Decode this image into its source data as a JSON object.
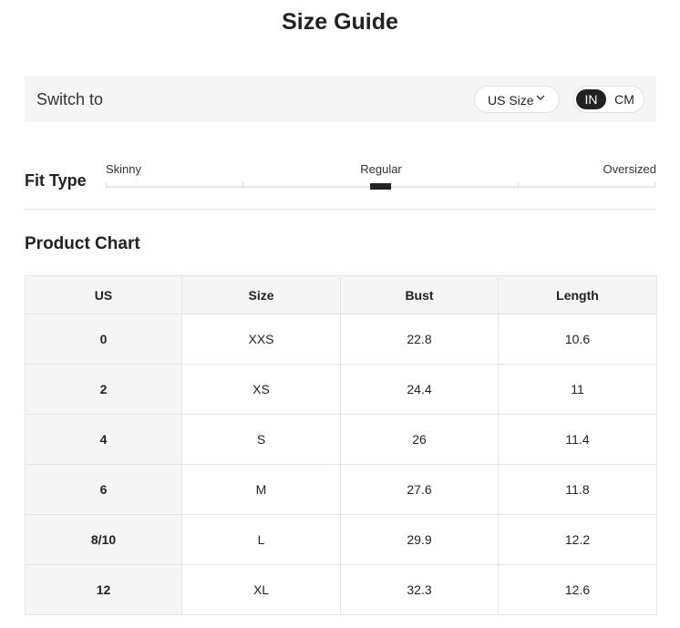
{
  "title": "Size Guide",
  "switch": {
    "label": "Switch to",
    "size_select_value": "US Size",
    "units": [
      "IN",
      "CM"
    ],
    "active_unit": "IN"
  },
  "fit": {
    "label": "Fit Type",
    "options": [
      "Skinny",
      "Regular",
      "Oversized"
    ],
    "selected": "Regular",
    "selected_fraction": 0.5
  },
  "chart": {
    "title": "Product Chart",
    "columns": [
      "US",
      "Size",
      "Bust",
      "Length"
    ],
    "rows": [
      [
        "0",
        "XXS",
        "22.8",
        "10.6"
      ],
      [
        "2",
        "XS",
        "24.4",
        "11"
      ],
      [
        "4",
        "S",
        "26",
        "11.4"
      ],
      [
        "6",
        "M",
        "27.6",
        "11.8"
      ],
      [
        "8/10",
        "L",
        "29.9",
        "12.2"
      ],
      [
        "12",
        "XL",
        "32.3",
        "12.6"
      ]
    ]
  },
  "colors": {
    "accent": "#222222",
    "panel_bg": "#f5f5f5",
    "border": "#e3e3e3"
  }
}
